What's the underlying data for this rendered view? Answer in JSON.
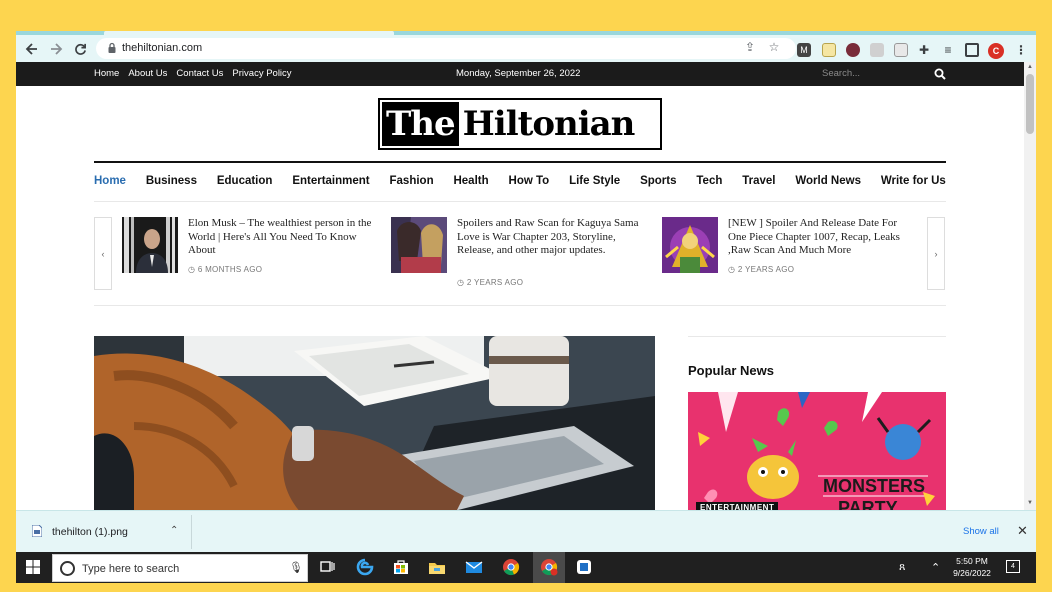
{
  "browser": {
    "url": "thehiltonian.com",
    "profile_initial": "C"
  },
  "site": {
    "top_links": [
      "Home",
      "About Us",
      "Contact Us",
      "Privacy Policy"
    ],
    "date": "Monday, September 26, 2022",
    "search_placeholder": "Search...",
    "logo_the": "The",
    "logo_rest": "Hiltonian",
    "nav": [
      "Home",
      "Business",
      "Education",
      "Entertainment",
      "Fashion",
      "Health",
      "How To",
      "Life Style",
      "Sports",
      "Tech",
      "Travel",
      "World News",
      "Write for Us"
    ],
    "ticker": [
      {
        "title": "Elon Musk – The wealthiest person in the World | Here's All You Need To Know About",
        "time": "6 MONTHS AGO"
      },
      {
        "title": "Spoilers and Raw Scan for Kaguya Sama Love is War Chapter 203, Storyline, Release, and other major updates.",
        "time": "2 YEARS AGO"
      },
      {
        "title": "[NEW ] Spoiler And Release Date For One Piece Chapter 1007, Recap, Leaks ,Raw Scan And Much More",
        "time": "2 YEARS AGO"
      }
    ],
    "popular_title": "Popular News",
    "popular_badge": "ENTERTAINMENT"
  },
  "downloads": {
    "file_name": "thehilton (1).png",
    "show_all": "Show all"
  },
  "taskbar": {
    "search_placeholder": "Type here to search",
    "time": "5:50 PM",
    "date": "9/26/2022",
    "notification_count": "4"
  },
  "colors": {
    "background": "#fdd54f",
    "chrome": "#e6f6f7",
    "accent_nav": "#2a6db0"
  }
}
